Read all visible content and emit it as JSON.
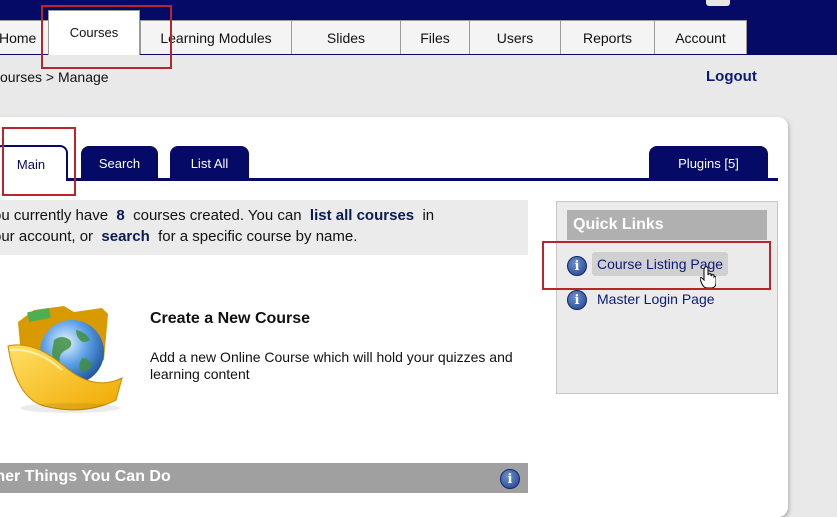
{
  "nav": {
    "tabs": [
      {
        "label": "Home"
      },
      {
        "label": "Courses",
        "active": true
      },
      {
        "label": "Learning Modules"
      },
      {
        "label": "Slides"
      },
      {
        "label": "Files"
      },
      {
        "label": "Users"
      },
      {
        "label": "Reports"
      },
      {
        "label": "Account"
      }
    ]
  },
  "breadcrumb": "ourses > Manage",
  "logout_label": "Logout",
  "subtabs": {
    "main": "Main",
    "search": "Search",
    "list_all": "List All",
    "plugins": "Plugins [5]"
  },
  "summary": {
    "part1": "ou currently have",
    "count": "8",
    "part2": "courses created. You can",
    "list_link": "list all courses",
    "part3": "in",
    "part4": "our account, or",
    "search_link": "search",
    "part5": "for a specific course by name."
  },
  "create": {
    "title": "Create a New Course",
    "description": "Add a new Online Course which will hold your quizzes and learning content"
  },
  "other": {
    "title": "ther Things You Can Do"
  },
  "quick_links": {
    "title": "Quick Links",
    "items": [
      {
        "label": "Course Listing Page",
        "icon": "info-icon"
      },
      {
        "label": "Master Login Page",
        "icon": "info-icon"
      }
    ]
  },
  "icons": {
    "info_glyph": "i"
  },
  "colors": {
    "brand_navy": "#050a66",
    "highlight_red": "#b8262c",
    "panel_gray": "#ebebeb"
  }
}
